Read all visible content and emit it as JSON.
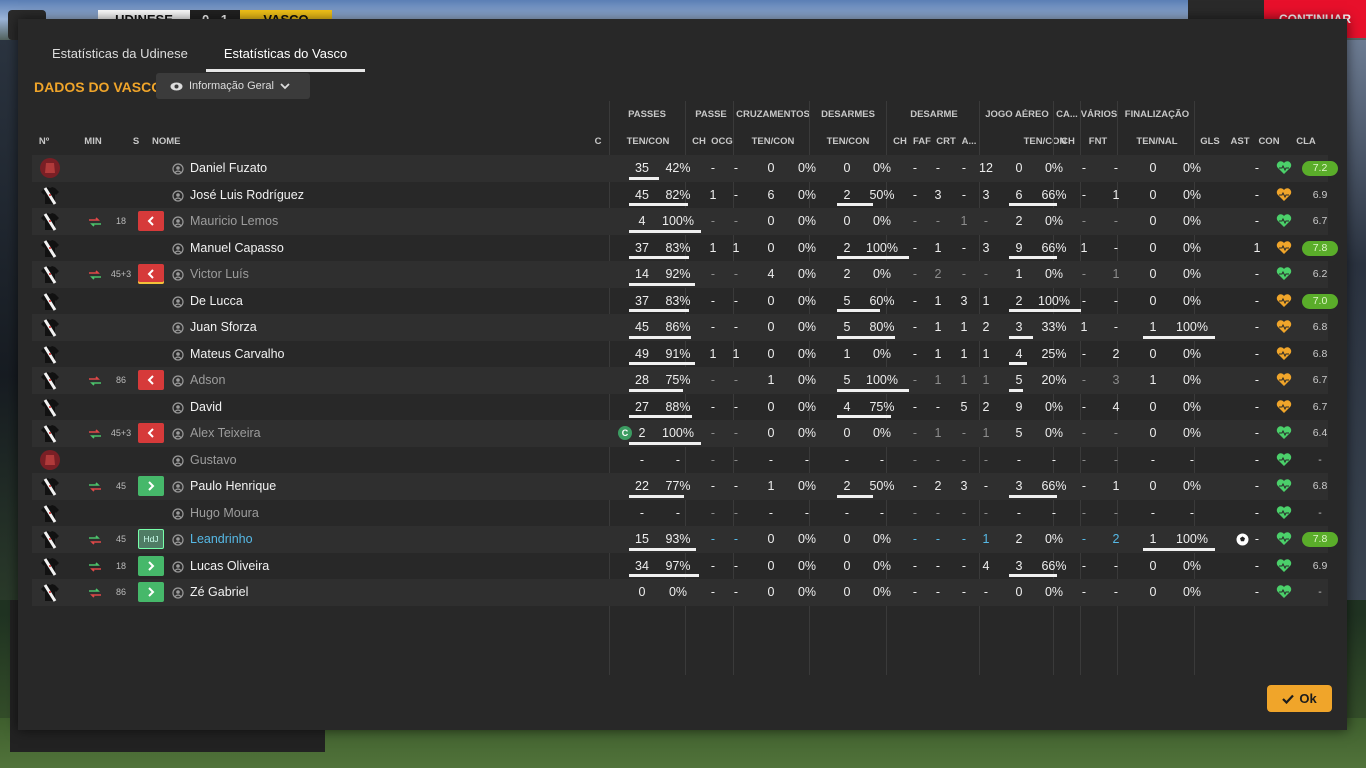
{
  "topbar": {
    "home_team": "UDINESE",
    "score": "0 - 1",
    "away_team": "VASCO",
    "continue_label": "CONTINUAR"
  },
  "tabs": [
    "Estatísticas da Udinese",
    "Estatísticas do Vasco"
  ],
  "section_title": "DADOS DO VASCO",
  "view_dropdown": "Informação Geral",
  "ok_label": "Ok",
  "group_headers": [
    "PASSES",
    "PASSE",
    "CRUZAMENTOS",
    "DESARMES",
    "DESARME",
    "JOGO AÉREO",
    "CA...",
    "VÁRIOS",
    "FINALIZAÇÃO"
  ],
  "column_headers": {
    "num": "Nº",
    "min": "MIN",
    "s": "S",
    "name": "NOME",
    "c": "C",
    "passes": "TEN/CON",
    "passe_ch": "CH",
    "passe_ocg": "OCG",
    "cruz": "TEN/CON",
    "desarmes": "TEN/CON",
    "des_ch": "CH",
    "des_faf": "FAF",
    "des_crt": "CRT",
    "des_a": "A...",
    "aereo": "TEN/CON",
    "ca_ch": "CH",
    "fnt": "FNT",
    "final": "TEN/NAL",
    "gls": "GLS",
    "ast": "AST",
    "con": "CON",
    "cla": "CLA"
  },
  "colors": {
    "accent": "#f0a52a",
    "sub_out": "#d63a3a",
    "sub_in": "#46b86a",
    "rating_high": "#5aad2a",
    "highlight": "#56b9e6"
  },
  "players": [
    {
      "name": "Daniel Fuzato",
      "kit": "gk",
      "min": "",
      "sub": "",
      "status": "",
      "captain": false,
      "passes": [
        "35",
        "42%"
      ],
      "passes_bar": 0.42,
      "pch": "-",
      "pocg": "-",
      "cruz": [
        "0",
        "0%"
      ],
      "cruz_bar": 0,
      "des": [
        "0",
        "0%"
      ],
      "des_bar": 0,
      "dch": "-",
      "dfaf": "-",
      "dcrt": "-",
      "da": "12",
      "aer": [
        "0",
        "0%"
      ],
      "aer_bar": 0,
      "cach": "-",
      "fnt": "-",
      "fin": [
        "0",
        "0%"
      ],
      "fin_bar": 0,
      "gls": "",
      "ast": "-",
      "con": "green",
      "cla": "7.2",
      "cla_hi": true
    },
    {
      "name": "José Luis Rodríguez",
      "kit": "field",
      "min": "",
      "sub": "",
      "status": "",
      "captain": false,
      "passes": [
        "45",
        "82%"
      ],
      "passes_bar": 0.82,
      "pch": "1",
      "pocg": "-",
      "cruz": [
        "6",
        "0%"
      ],
      "cruz_bar": 0,
      "des": [
        "2",
        "50%"
      ],
      "des_bar": 0.5,
      "dch": "-",
      "dfaf": "3",
      "dcrt": "-",
      "da": "3",
      "aer": [
        "6",
        "66%"
      ],
      "aer_bar": 0.66,
      "cach": "-",
      "fnt": "1",
      "fin": [
        "0",
        "0%"
      ],
      "fin_bar": 0,
      "gls": "",
      "ast": "-",
      "con": "orange",
      "cla": "6.9",
      "cla_hi": false
    },
    {
      "name": "Mauricio Lemos",
      "kit": "field",
      "min": "18",
      "sub": "out",
      "status": "sub",
      "captain": false,
      "passes": [
        "4",
        "100%"
      ],
      "passes_bar": 1,
      "pch": "-",
      "pocg": "-",
      "cruz": [
        "0",
        "0%"
      ],
      "cruz_bar": 0,
      "des": [
        "0",
        "0%"
      ],
      "des_bar": 0,
      "dch": "-",
      "dfaf": "-",
      "dcrt": "1",
      "da": "-",
      "aer": [
        "2",
        "0%"
      ],
      "aer_bar": 0,
      "cach": "-",
      "fnt": "-",
      "fin": [
        "0",
        "0%"
      ],
      "fin_bar": 0,
      "gls": "",
      "ast": "-",
      "con": "green",
      "cla": "6.7",
      "cla_hi": false
    },
    {
      "name": "Manuel Capasso",
      "kit": "field",
      "min": "",
      "sub": "",
      "status": "",
      "captain": false,
      "passes": [
        "37",
        "83%"
      ],
      "passes_bar": 0.83,
      "pch": "1",
      "pocg": "1",
      "cruz": [
        "0",
        "0%"
      ],
      "cruz_bar": 0,
      "des": [
        "2",
        "100%"
      ],
      "des_bar": 1,
      "dch": "-",
      "dfaf": "1",
      "dcrt": "-",
      "da": "3",
      "aer": [
        "9",
        "66%"
      ],
      "aer_bar": 0.66,
      "cach": "1",
      "fnt": "-",
      "fin": [
        "0",
        "0%"
      ],
      "fin_bar": 0,
      "gls": "",
      "ast": "1",
      "con": "orange",
      "cla": "7.8",
      "cla_hi": true
    },
    {
      "name": "Victor Luís",
      "kit": "field",
      "min": "45+3",
      "sub": "out-yc",
      "status": "sub",
      "captain": false,
      "passes": [
        "14",
        "92%"
      ],
      "passes_bar": 0.92,
      "pch": "-",
      "pocg": "-",
      "cruz": [
        "4",
        "0%"
      ],
      "cruz_bar": 0,
      "des": [
        "2",
        "0%"
      ],
      "des_bar": 0,
      "dch": "-",
      "dfaf": "2",
      "dcrt": "-",
      "da": "-",
      "aer": [
        "1",
        "0%"
      ],
      "aer_bar": 0,
      "cach": "-",
      "fnt": "1",
      "fin": [
        "0",
        "0%"
      ],
      "fin_bar": 0,
      "gls": "",
      "ast": "-",
      "con": "green",
      "cla": "6.2",
      "cla_hi": false
    },
    {
      "name": "De Lucca",
      "kit": "field",
      "min": "",
      "sub": "",
      "status": "",
      "captain": false,
      "passes": [
        "37",
        "83%"
      ],
      "passes_bar": 0.83,
      "pch": "-",
      "pocg": "-",
      "cruz": [
        "0",
        "0%"
      ],
      "cruz_bar": 0,
      "des": [
        "5",
        "60%"
      ],
      "des_bar": 0.6,
      "dch": "-",
      "dfaf": "1",
      "dcrt": "3",
      "da": "1",
      "aer": [
        "2",
        "100%"
      ],
      "aer_bar": 1,
      "cach": "-",
      "fnt": "-",
      "fin": [
        "0",
        "0%"
      ],
      "fin_bar": 0,
      "gls": "",
      "ast": "-",
      "con": "orange",
      "cla": "7.0",
      "cla_hi": true
    },
    {
      "name": "Juan Sforza",
      "kit": "field",
      "min": "",
      "sub": "",
      "status": "",
      "captain": false,
      "passes": [
        "45",
        "86%"
      ],
      "passes_bar": 0.86,
      "pch": "-",
      "pocg": "-",
      "cruz": [
        "0",
        "0%"
      ],
      "cruz_bar": 0,
      "des": [
        "5",
        "80%"
      ],
      "des_bar": 0.8,
      "dch": "-",
      "dfaf": "1",
      "dcrt": "1",
      "da": "2",
      "aer": [
        "3",
        "33%"
      ],
      "aer_bar": 0.33,
      "cach": "1",
      "fnt": "-",
      "fin": [
        "1",
        "100%"
      ],
      "fin_bar": 1,
      "gls": "",
      "ast": "-",
      "con": "orange",
      "cla": "6.8",
      "cla_hi": false
    },
    {
      "name": "Mateus Carvalho",
      "kit": "field",
      "min": "",
      "sub": "",
      "status": "",
      "captain": false,
      "passes": [
        "49",
        "91%"
      ],
      "passes_bar": 0.91,
      "pch": "1",
      "pocg": "1",
      "cruz": [
        "0",
        "0%"
      ],
      "cruz_bar": 0,
      "des": [
        "1",
        "0%"
      ],
      "des_bar": 0,
      "dch": "-",
      "dfaf": "1",
      "dcrt": "1",
      "da": "1",
      "aer": [
        "4",
        "25%"
      ],
      "aer_bar": 0.25,
      "cach": "-",
      "fnt": "2",
      "fin": [
        "0",
        "0%"
      ],
      "fin_bar": 0,
      "gls": "",
      "ast": "-",
      "con": "orange",
      "cla": "6.8",
      "cla_hi": false
    },
    {
      "name": "Adson",
      "kit": "field",
      "min": "86",
      "sub": "out",
      "status": "sub",
      "captain": false,
      "passes": [
        "28",
        "75%"
      ],
      "passes_bar": 0.75,
      "pch": "-",
      "pocg": "-",
      "cruz": [
        "1",
        "0%"
      ],
      "cruz_bar": 0,
      "des": [
        "5",
        "100%"
      ],
      "des_bar": 1,
      "dch": "-",
      "dfaf": "1",
      "dcrt": "1",
      "da": "1",
      "aer": [
        "5",
        "20%"
      ],
      "aer_bar": 0.2,
      "cach": "-",
      "fnt": "3",
      "fin": [
        "1",
        "0%"
      ],
      "fin_bar": 0,
      "gls": "",
      "ast": "-",
      "con": "orange",
      "cla": "6.7",
      "cla_hi": false
    },
    {
      "name": "David",
      "kit": "field",
      "min": "",
      "sub": "",
      "status": "",
      "captain": false,
      "passes": [
        "27",
        "88%"
      ],
      "passes_bar": 0.88,
      "pch": "-",
      "pocg": "-",
      "cruz": [
        "0",
        "0%"
      ],
      "cruz_bar": 0,
      "des": [
        "4",
        "75%"
      ],
      "des_bar": 0.75,
      "dch": "-",
      "dfaf": "-",
      "dcrt": "5",
      "da": "2",
      "aer": [
        "9",
        "0%"
      ],
      "aer_bar": 0,
      "cach": "-",
      "fnt": "4",
      "fin": [
        "0",
        "0%"
      ],
      "fin_bar": 0,
      "gls": "",
      "ast": "-",
      "con": "orange",
      "cla": "6.7",
      "cla_hi": false
    },
    {
      "name": "Alex Teixeira",
      "kit": "field",
      "min": "45+3",
      "sub": "out",
      "status": "sub",
      "captain": true,
      "captain_label": "C",
      "passes": [
        "2",
        "100%"
      ],
      "passes_bar": 1,
      "pch": "-",
      "pocg": "-",
      "cruz": [
        "0",
        "0%"
      ],
      "cruz_bar": 0,
      "des": [
        "0",
        "0%"
      ],
      "des_bar": 0,
      "dch": "-",
      "dfaf": "1",
      "dcrt": "-",
      "da": "1",
      "aer": [
        "5",
        "0%"
      ],
      "aer_bar": 0,
      "cach": "-",
      "fnt": "-",
      "fin": [
        "0",
        "0%"
      ],
      "fin_bar": 0,
      "gls": "",
      "ast": "-",
      "con": "green",
      "cla": "6.4",
      "cla_hi": false
    },
    {
      "name": "Gustavo",
      "kit": "gk",
      "min": "",
      "sub": "",
      "status": "bench",
      "captain": false,
      "passes": [
        "-",
        "-"
      ],
      "passes_bar": 0,
      "pch": "-",
      "pocg": "-",
      "cruz": [
        "-",
        "-"
      ],
      "cruz_bar": 0,
      "des": [
        "-",
        "-"
      ],
      "des_bar": 0,
      "dch": "-",
      "dfaf": "-",
      "dcrt": "-",
      "da": "-",
      "aer": [
        "-",
        "-"
      ],
      "aer_bar": 0,
      "cach": "-",
      "fnt": "-",
      "fin": [
        "-",
        "-"
      ],
      "fin_bar": 0,
      "gls": "",
      "ast": "-",
      "con": "green",
      "cla": "-",
      "cla_hi": false
    },
    {
      "name": "Paulo Henrique",
      "kit": "field",
      "min": "45",
      "sub": "in",
      "status": "",
      "captain": false,
      "passes": [
        "22",
        "77%"
      ],
      "passes_bar": 0.77,
      "pch": "-",
      "pocg": "-",
      "cruz": [
        "1",
        "0%"
      ],
      "cruz_bar": 0,
      "des": [
        "2",
        "50%"
      ],
      "des_bar": 0.5,
      "dch": "-",
      "dfaf": "2",
      "dcrt": "3",
      "da": "-",
      "aer": [
        "3",
        "66%"
      ],
      "aer_bar": 0.66,
      "cach": "-",
      "fnt": "1",
      "fin": [
        "0",
        "0%"
      ],
      "fin_bar": 0,
      "gls": "",
      "ast": "-",
      "con": "green",
      "cla": "6.8",
      "cla_hi": false
    },
    {
      "name": "Hugo Moura",
      "kit": "field",
      "min": "",
      "sub": "",
      "status": "bench",
      "captain": false,
      "passes": [
        "-",
        "-"
      ],
      "passes_bar": 0,
      "pch": "-",
      "pocg": "-",
      "cruz": [
        "-",
        "-"
      ],
      "cruz_bar": 0,
      "des": [
        "-",
        "-"
      ],
      "des_bar": 0,
      "dch": "-",
      "dfaf": "-",
      "dcrt": "-",
      "da": "-",
      "aer": [
        "-",
        "-"
      ],
      "aer_bar": 0,
      "cach": "-",
      "fnt": "-",
      "fin": [
        "-",
        "-"
      ],
      "fin_bar": 0,
      "gls": "",
      "ast": "-",
      "con": "green",
      "cla": "-",
      "cla_hi": false
    },
    {
      "name": "Leandrinho",
      "kit": "field",
      "min": "45",
      "sub": "hdj",
      "sub_label": "HdJ",
      "status": "highlight",
      "captain": false,
      "passes": [
        "15",
        "93%"
      ],
      "passes_bar": 0.93,
      "pch": "-",
      "pocg": "-",
      "cruz": [
        "0",
        "0%"
      ],
      "cruz_bar": 0,
      "des": [
        "0",
        "0%"
      ],
      "des_bar": 0,
      "dch": "-",
      "dfaf": "-",
      "dcrt": "-",
      "da": "1",
      "aer": [
        "2",
        "0%"
      ],
      "aer_bar": 0,
      "cach": "-",
      "fnt": "2",
      "fin": [
        "1",
        "100%"
      ],
      "fin_bar": 1,
      "gls": "ball",
      "ast": "-",
      "con": "green",
      "cla": "7.8",
      "cla_hi": true
    },
    {
      "name": "Lucas Oliveira",
      "kit": "field",
      "min": "18",
      "sub": "in",
      "status": "",
      "captain": false,
      "passes": [
        "34",
        "97%"
      ],
      "passes_bar": 0.97,
      "pch": "-",
      "pocg": "-",
      "cruz": [
        "0",
        "0%"
      ],
      "cruz_bar": 0,
      "des": [
        "0",
        "0%"
      ],
      "des_bar": 0,
      "dch": "-",
      "dfaf": "-",
      "dcrt": "-",
      "da": "4",
      "aer": [
        "3",
        "66%"
      ],
      "aer_bar": 0.66,
      "cach": "-",
      "fnt": "-",
      "fin": [
        "0",
        "0%"
      ],
      "fin_bar": 0,
      "gls": "",
      "ast": "-",
      "con": "green",
      "cla": "6.9",
      "cla_hi": false
    },
    {
      "name": "Zé Gabriel",
      "kit": "field",
      "min": "86",
      "sub": "in",
      "status": "",
      "captain": false,
      "passes": [
        "0",
        "0%"
      ],
      "passes_bar": 0,
      "pch": "-",
      "pocg": "-",
      "cruz": [
        "0",
        "0%"
      ],
      "cruz_bar": 0,
      "des": [
        "0",
        "0%"
      ],
      "des_bar": 0,
      "dch": "-",
      "dfaf": "-",
      "dcrt": "-",
      "da": "-",
      "aer": [
        "0",
        "0%"
      ],
      "aer_bar": 0,
      "cach": "-",
      "fnt": "-",
      "fin": [
        "0",
        "0%"
      ],
      "fin_bar": 0,
      "gls": "",
      "ast": "-",
      "con": "green",
      "cla": "-",
      "cla_hi": false
    }
  ]
}
